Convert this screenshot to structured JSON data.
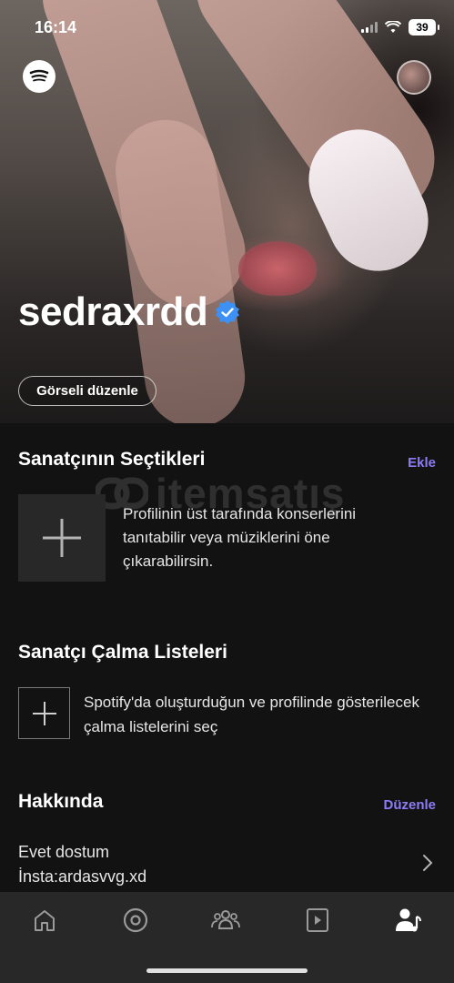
{
  "status_bar": {
    "time": "16:14",
    "battery": "39"
  },
  "hero": {
    "artist_name": "sedraxrdd",
    "edit_image_label": "Görseli düzenle"
  },
  "artist_picks": {
    "title": "Sanatçının Seçtikleri",
    "action": "Ekle",
    "description": "Profilinin üst tarafında konserlerini tanıtabilir veya müziklerini öne çıkarabilirsin."
  },
  "artist_playlists": {
    "title": "Sanatçı Çalma Listeleri",
    "description": "Spotify'da oluşturduğun ve profilinde gösterilecek çalma listelerini seç"
  },
  "about": {
    "title": "Hakkında",
    "action": "Düzenle",
    "line1": "Evet dostum",
    "line2": "İnsta:ardasvvg.xd"
  },
  "watermark": "itemsatış",
  "bottom_nav": {
    "items": [
      "home-icon",
      "radio-icon",
      "audience-icon",
      "play-icon",
      "profile-icon"
    ],
    "active": "profile-icon"
  },
  "colors": {
    "accent": "#8c7cf5",
    "background": "#121212",
    "nav": "#282828",
    "verified": "#3d91f4"
  }
}
